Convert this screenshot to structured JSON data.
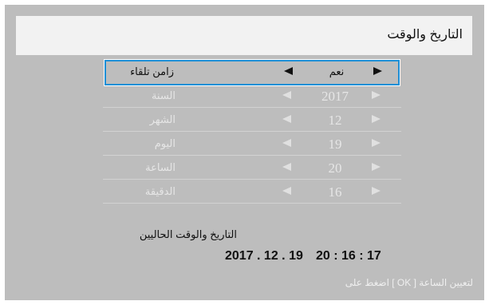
{
  "title": "التاريخ والوقت",
  "rows": [
    {
      "label": "زامن تلقاء",
      "value": "نعم"
    },
    {
      "label": "السنة",
      "value": "2017"
    },
    {
      "label": "الشهر",
      "value": "12"
    },
    {
      "label": "اليوم",
      "value": "19"
    },
    {
      "label": "الساعة",
      "value": "20"
    },
    {
      "label": "الدقيقة",
      "value": "16"
    }
  ],
  "current": {
    "label": "التاريخ والوقت الحاليين",
    "date": "2017 . 12 . 19",
    "time": "20 : 16 : 17"
  },
  "hint": "اضغط على [ OK ] لتعيين الساعة",
  "colors": {
    "panel_background": "#bdbdbd",
    "titlebar_background": "#f2f2f2",
    "selection_border": "#1e8fd6",
    "active_text": "#111111",
    "inactive_text": "#e6e6e6"
  },
  "icons": {
    "decrease": "triangle-left-icon",
    "increase": "triangle-right-icon"
  }
}
